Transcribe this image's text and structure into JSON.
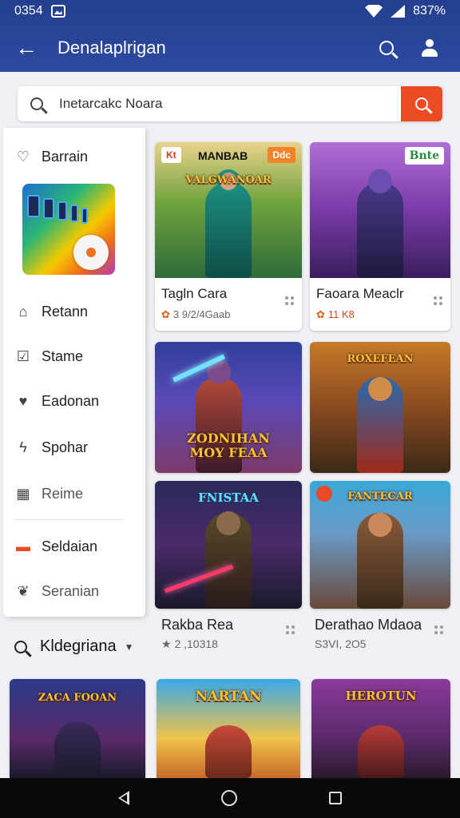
{
  "status": {
    "time": "0354",
    "battery": "837%"
  },
  "appbar": {
    "title": "Denalaplrigan"
  },
  "search": {
    "placeholder": "Inetarcakc Noara"
  },
  "sidebar": {
    "items": [
      {
        "label": "Barrain",
        "icon": "shield-outline-icon"
      },
      {
        "label": "Retann",
        "icon": "home-outline-icon"
      },
      {
        "label": "Stame",
        "icon": "checkmark-shield-icon"
      },
      {
        "label": "Eadonan",
        "icon": "heart-shield-icon"
      },
      {
        "label": "Spohar",
        "icon": "flash-shield-icon"
      },
      {
        "label": "Reime",
        "icon": "grid-icon"
      },
      {
        "label": "Seldaian",
        "icon": "gamepad-icon"
      },
      {
        "label": "Seranian",
        "icon": "leaf-icon"
      }
    ]
  },
  "category": {
    "label": "Kldegriana"
  },
  "cards": [
    {
      "badge": "MANBAB",
      "badge_left": "Kt",
      "badge_right": "Ddc",
      "title": "Tagln Cara",
      "meta": "3 9/2/4Gaab",
      "meta_prefix": "✿"
    },
    {
      "badge": "Bnte",
      "title": "Faoara Meaclr",
      "meta": "11 K8",
      "meta_prefix": "✿"
    },
    {
      "banner_top": "",
      "banner": "ZODNIHAN\nMOY FEAA"
    },
    {
      "banner": "ROXEFEAN"
    },
    {
      "banner": "FNISTAA",
      "title": "Rakba Rea",
      "meta": "2 ,10318",
      "meta_prefix": "★"
    },
    {
      "banner": "FANTECAR",
      "title": "Derathao Mdaoa",
      "meta": "S3VI, 2O5"
    },
    {
      "banner": "ZACA FOOAN"
    },
    {
      "banner": "NARTAN"
    },
    {
      "banner": "HEROTUN"
    }
  ],
  "colors": {
    "appbar": "#2c4aa0",
    "accent": "#ec4a22"
  }
}
